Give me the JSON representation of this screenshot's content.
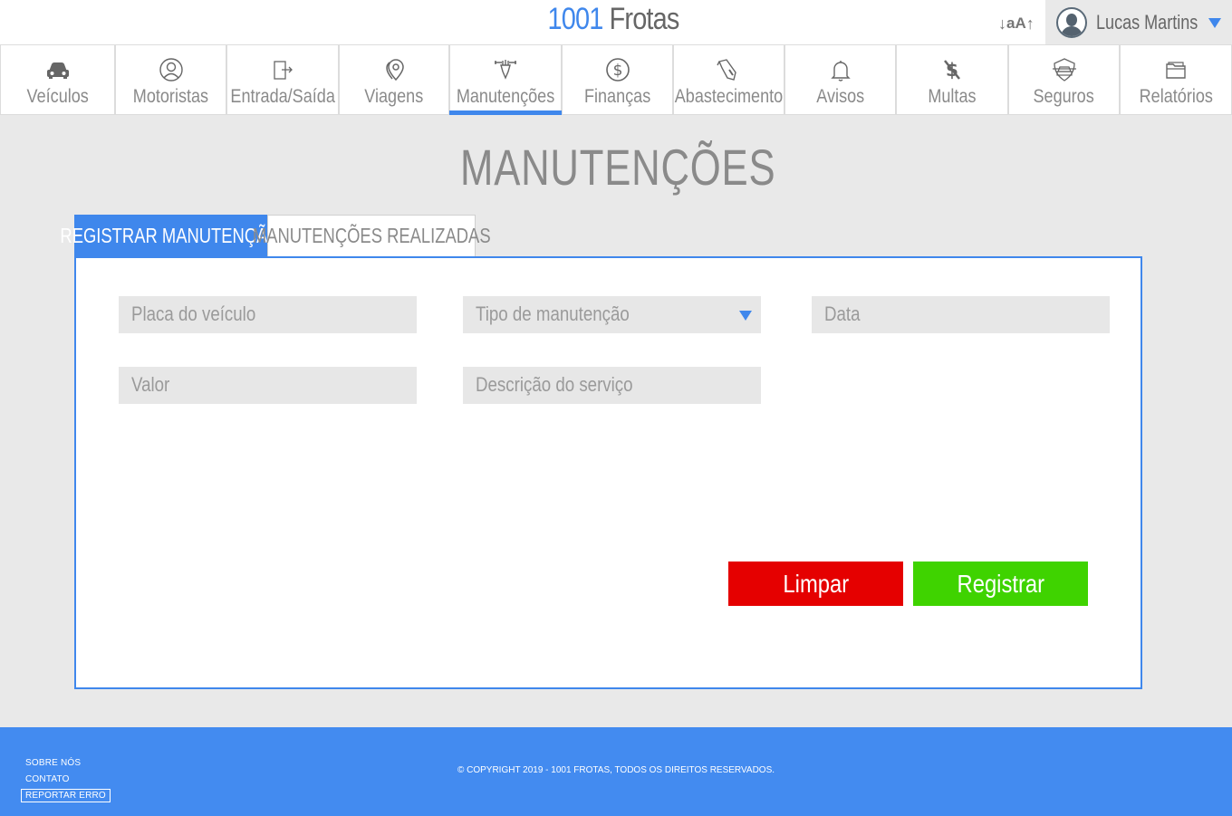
{
  "header": {
    "brand_number": "1001",
    "brand_name": "Frotas",
    "font_size_label": "aA",
    "user_name": "Lucas Martins"
  },
  "nav": [
    {
      "label": "Veículos",
      "icon": "car-icon"
    },
    {
      "label": "Motoristas",
      "icon": "driver-icon"
    },
    {
      "label": "Entrada/Saída",
      "icon": "door-icon"
    },
    {
      "label": "Viagens",
      "icon": "map-pin-icon"
    },
    {
      "label": "Manutenções",
      "icon": "wrench-hand-icon",
      "active": true
    },
    {
      "label": "Finanças",
      "icon": "dollar-circle-icon"
    },
    {
      "label": "Abastecimento",
      "icon": "fuel-nozzle-icon"
    },
    {
      "label": "Avisos",
      "icon": "bell-icon"
    },
    {
      "label": "Multas",
      "icon": "dollar-slash-icon"
    },
    {
      "label": "Seguros",
      "icon": "car-shield-icon"
    },
    {
      "label": "Relatórios",
      "icon": "folder-icon"
    }
  ],
  "page": {
    "title": "MANUTENÇÕES",
    "tabs": {
      "register": "REGISTRAR MANUTENÇÃO",
      "done": "MANUTENÇÕES REALIZADAS"
    }
  },
  "form": {
    "plate_placeholder": "Placa do veículo",
    "type_placeholder": "Tipo de manutenção",
    "date_placeholder": "Data",
    "value_placeholder": "Valor",
    "description_placeholder": "Descrição do serviço",
    "clear_label": "Limpar",
    "register_label": "Registrar"
  },
  "footer": {
    "about": "SOBRE NÓS",
    "contact": "CONTATO",
    "report": "REPORTAR ERRO",
    "copyright": "© COPYRIGHT 2019 - 1001 FROTAS, TODOS OS DIREITOS RESERVADOS."
  },
  "colors": {
    "accent": "#3f87ec",
    "clear_button": "#e50000",
    "register_button": "#3fd300",
    "footer": "#438bf0"
  }
}
